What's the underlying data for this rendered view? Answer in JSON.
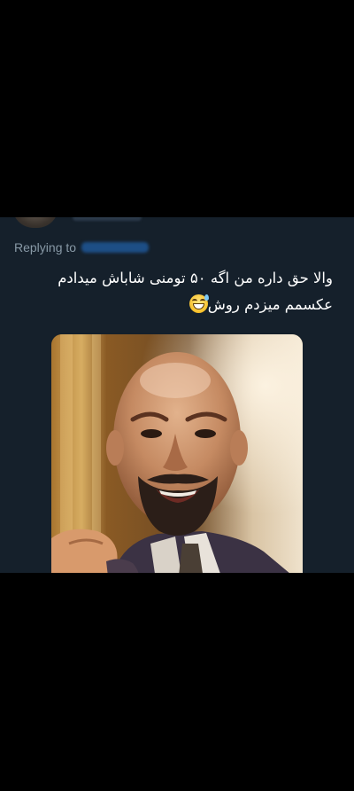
{
  "reply": {
    "replying_to_label": "Replying to"
  },
  "tweet": {
    "text_line_1": "والا حق داره من اگه ۵۰ تومنی شاباش میدادم",
    "text_line_2": "عکسمم میزدم روش",
    "emoji_icon": "grinning-face-with-sweat-icon"
  },
  "colors": {
    "background": "#000000",
    "card_background": "#15202b",
    "secondary_text": "#8899a6",
    "primary_text": "#ffffff",
    "mention_blue": "#1d9bf0"
  }
}
